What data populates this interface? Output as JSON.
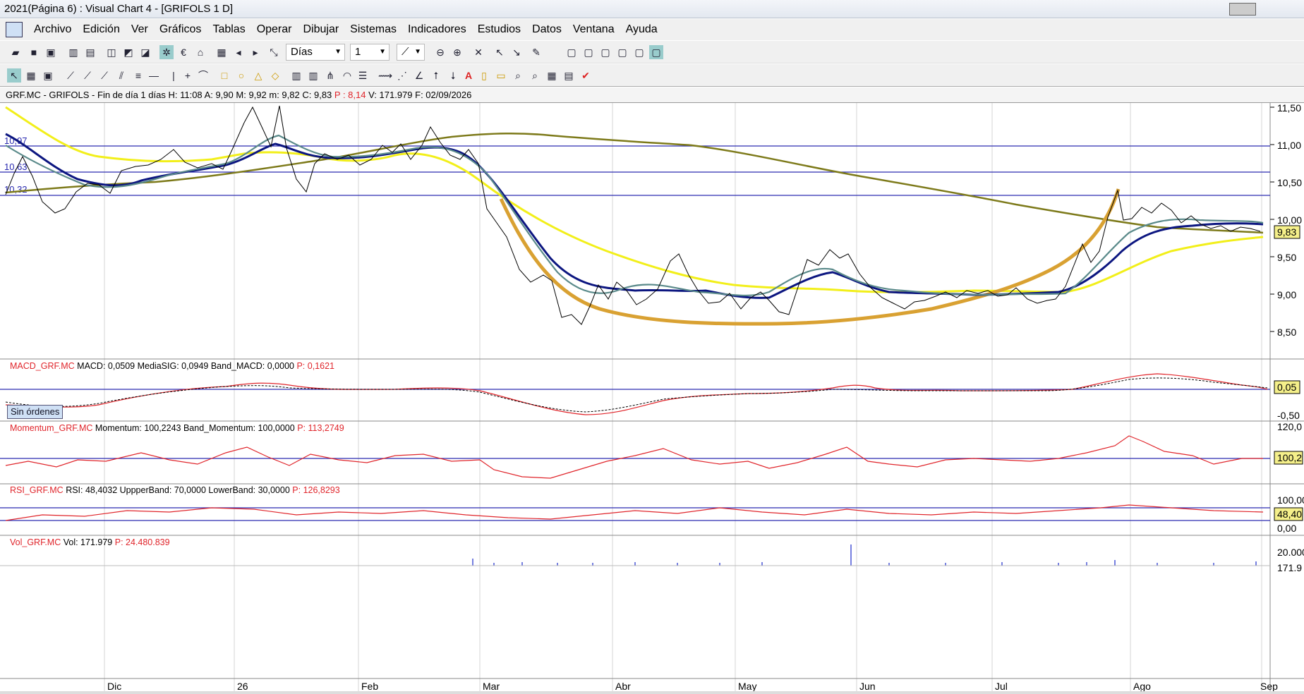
{
  "window": {
    "title": "2021(Página 6) : Visual Chart 4 - [GRIFOLS 1 D]"
  },
  "menu": [
    "Archivo",
    "Edición",
    "Ver",
    "Gráficos",
    "Tablas",
    "Operar",
    "Dibujar",
    "Sistemas",
    "Indicadores",
    "Estudios",
    "Datos",
    "Ventana",
    "Ayuda"
  ],
  "toolbar": {
    "period": "Días",
    "compression": "1"
  },
  "infobar": {
    "prefix": "GRF.MC - GRIFOLS - Fin de día 1 días",
    "high": "H: 11:08",
    "ask": "A: 9,90",
    "max": "M: 9,92",
    "min": "m: 9,82",
    "close": "C: 9,83",
    "p": "P : 8,14",
    "vol": "V: 171.979",
    "date": "F: 02/09/2026"
  },
  "main_chart": {
    "y_ticks": [
      "11,50",
      "11,00",
      "10,50",
      "10,00",
      "9,50",
      "9,00",
      "8,50"
    ],
    "hlines": [
      "10,97",
      "10,63",
      "10,32"
    ],
    "last_price": "9,83",
    "orders_button": "Sin órdenes"
  },
  "x_axis": [
    "Dic",
    "26",
    "Feb",
    "Mar",
    "Abr",
    "May",
    "Jun",
    "Jul",
    "Ago",
    "Sep"
  ],
  "panels": [
    {
      "label_name": "MACD_GRF.MC",
      "label_rest": "MACD: 0,0509  MediaSIG: 0,0949  Band_MACD: 0,0000",
      "label_p": "P: 0,1621",
      "ticks": [
        "0,05",
        "-0,50"
      ]
    },
    {
      "label_name": "Momentum_GRF.MC",
      "label_rest": "Momentum: 100,2243  Band_Momentum: 100,0000",
      "label_p": "P: 113,2749",
      "ticks": [
        "120,0",
        "100,2"
      ]
    },
    {
      "label_name": "RSI_GRF.MC",
      "label_rest": "RSI: 48,4032  UppperBand: 70,0000  LowerBand: 30,0000",
      "label_p": "P: 126,8293",
      "ticks": [
        "100,00",
        "48,40",
        "0,00"
      ]
    },
    {
      "label_name": "Vol_GRF.MC",
      "label_rest": "Vol: 171.979",
      "label_p": "P: 24.480.839",
      "ticks": [
        "20.000",
        "171.9"
      ]
    }
  ],
  "colors": {
    "price": "#000000",
    "ma_fast": "#5a8a8a",
    "ma_mid": "#0c1680",
    "ma_yellow": "#f2ef1a",
    "ma_long": "#7d7a1a",
    "cup": "#d9a132",
    "hline": "#2a2ab0",
    "indicator": "#e0252b"
  }
}
